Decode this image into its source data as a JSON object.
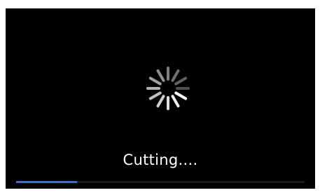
{
  "loading": {
    "spinner_icon": "spinner-icon",
    "status_text": "Cutting....",
    "progress_percent": 21
  },
  "colors": {
    "background": "#000000",
    "text": "#ffffff",
    "progress": "#3a6fc4"
  }
}
